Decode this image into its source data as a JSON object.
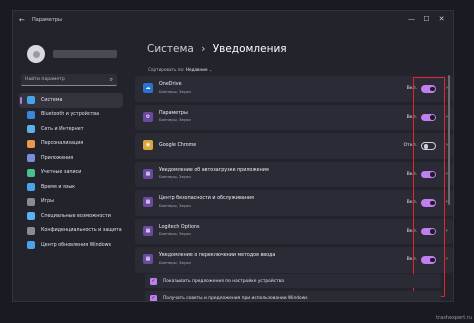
{
  "window": {
    "title": "Параметры",
    "back_icon": "arrow-left-icon",
    "controls": [
      "—",
      "☐",
      "✕"
    ]
  },
  "sidebar": {
    "search_placeholder": "Найти параметр",
    "items": [
      {
        "label": "Система",
        "icon": "system-icon",
        "color": "#4aa3e8",
        "active": true
      },
      {
        "label": "Bluetooth и устройства",
        "icon": "bluetooth-icon",
        "color": "#3a86d8"
      },
      {
        "label": "Сеть и Интернет",
        "icon": "network-icon",
        "color": "#5bb0e8"
      },
      {
        "label": "Персонализация",
        "icon": "brush-icon",
        "color": "#e89a4a"
      },
      {
        "label": "Приложения",
        "icon": "apps-icon",
        "color": "#7c8cd8"
      },
      {
        "label": "Учетные записи",
        "icon": "account-icon",
        "color": "#4ac08a"
      },
      {
        "label": "Время и язык",
        "icon": "clock-icon",
        "color": "#4aa3e8"
      },
      {
        "label": "Игры",
        "icon": "gamepad-icon",
        "color": "#8a8a94"
      },
      {
        "label": "Специальные возможности",
        "icon": "accessibility-icon",
        "color": "#5ab0f0"
      },
      {
        "label": "Конфиденциальность и защита",
        "icon": "shield-icon",
        "color": "#8a8a94"
      },
      {
        "label": "Центр обновления Windows",
        "icon": "update-icon",
        "color": "#4aa3e8"
      }
    ]
  },
  "main": {
    "breadcrumb_parent": "Система",
    "breadcrumb_sep": "›",
    "title": "Уведомления",
    "sort_label": "Сортировать по:",
    "sort_value": "Недавние",
    "rows": [
      {
        "name": "OneDrive",
        "sub": "Баннеры, Звуки",
        "state": "Вкл.",
        "on": true,
        "icon": "onedrive-icon",
        "icon_color": "#2a72d0",
        "glyph": "☁"
      },
      {
        "name": "Параметры",
        "sub": "Баннеры, Звуки",
        "state": "Вкл.",
        "on": true,
        "icon": "settings-icon",
        "icon_color": "#6a4aa0",
        "glyph": "⚙"
      },
      {
        "name": "Google Chrome",
        "sub": "",
        "state": "Откл.",
        "on": false,
        "icon": "chrome-icon",
        "icon_color": "#d9a83a",
        "glyph": "◉"
      },
      {
        "name": "Уведомление об автозагрузке приложения",
        "sub": "Баннеры, Звуки",
        "state": "Вкл.",
        "on": true,
        "icon": "startup-icon",
        "icon_color": "#6a4aa0",
        "glyph": "▦"
      },
      {
        "name": "Центр безопасности и обслуживания",
        "sub": "Баннеры, Звуки",
        "state": "Вкл.",
        "on": true,
        "icon": "security-center-icon",
        "icon_color": "#6a4aa0",
        "glyph": "▦"
      },
      {
        "name": "Logitech Options",
        "sub": "Баннеры, Звуки",
        "state": "Вкл.",
        "on": true,
        "icon": "logitech-icon",
        "icon_color": "#6a4aa0",
        "glyph": "▦"
      },
      {
        "name": "Уведомление о переключении методов ввода",
        "sub": "Баннеры, Звуки",
        "state": "Вкл.",
        "on": true,
        "icon": "input-method-icon",
        "icon_color": "#6a4aa0",
        "glyph": "▦"
      }
    ],
    "checks": [
      {
        "label": "Показывать предложения по настройке устройства",
        "checked": true
      },
      {
        "label": "Получать советы и предложения при использовании Windows",
        "checked": true
      }
    ]
  },
  "watermark": "trashexpert.ru",
  "colors": {
    "accent": "#c07ef0",
    "highlight": "#e3262d",
    "background": "#23232c"
  }
}
